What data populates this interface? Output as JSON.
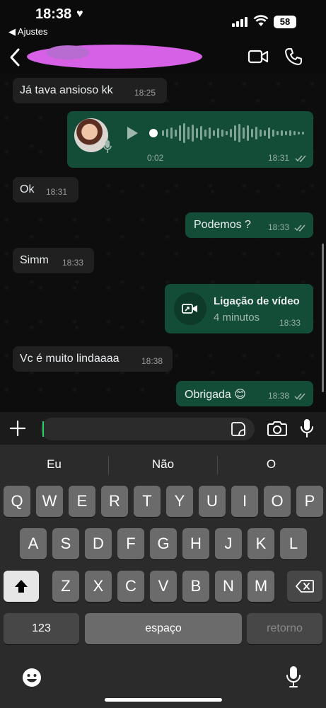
{
  "status_bar": {
    "time": "18:38",
    "back_app": "◀ Ajustes",
    "battery": "58"
  },
  "chat_header": {
    "contact_name": ""
  },
  "messages": [
    {
      "text": "Já tava ansioso kk",
      "time": "18:25"
    },
    {
      "audio_duration": "0:02",
      "time": "18:31"
    },
    {
      "text": "Ok",
      "time": "18:31"
    },
    {
      "text": "Podemos ?",
      "time": "18:33"
    },
    {
      "text": "Simm",
      "time": "18:33"
    },
    {
      "call_title": "Ligação de vídeo",
      "call_duration": "4 minutos",
      "time": "18:33"
    },
    {
      "text": "Vc é muito lindaaaa",
      "time": "18:38"
    },
    {
      "text": "Obrigada 😊",
      "time": "18:38"
    }
  ],
  "input": {
    "placeholder": ""
  },
  "keyboard": {
    "suggestions": [
      "Eu",
      "Não",
      "O"
    ],
    "row1": [
      "Q",
      "W",
      "E",
      "R",
      "T",
      "Y",
      "U",
      "I",
      "O",
      "P"
    ],
    "row2": [
      "A",
      "S",
      "D",
      "F",
      "G",
      "H",
      "J",
      "K",
      "L"
    ],
    "row3": [
      "Z",
      "X",
      "C",
      "V",
      "B",
      "N",
      "M"
    ],
    "numbers_key": "123",
    "space_key": "espaço",
    "return_key": "retorno"
  },
  "colors": {
    "outgoing_bubble": "#144d37",
    "incoming_bubble": "#202020",
    "accent": "#25d366",
    "read_ticks": "#9fb8ad"
  },
  "icons": [
    "heart-icon",
    "signal-icon",
    "wifi-icon",
    "back-chevron-icon",
    "video-call-icon",
    "phone-icon",
    "play-icon",
    "mic-icon",
    "plus-icon",
    "sticker-icon",
    "camera-icon",
    "shift-icon",
    "backspace-icon",
    "emoji-icon",
    "dictation-mic-icon",
    "video-call-arrow-icon"
  ]
}
